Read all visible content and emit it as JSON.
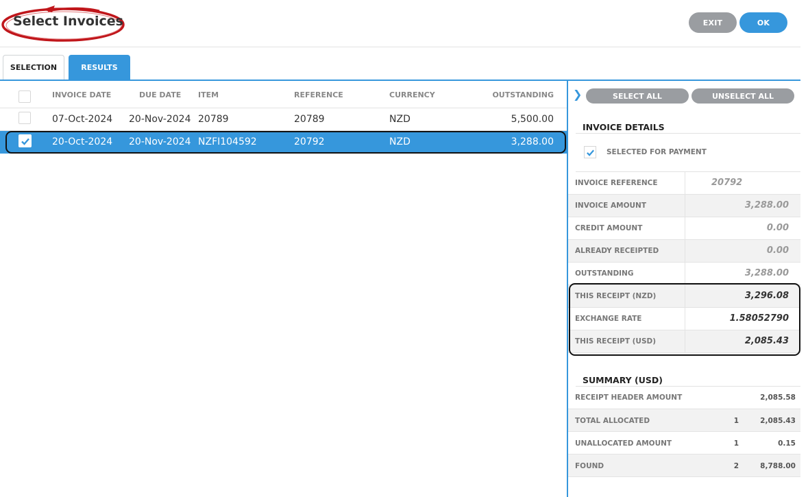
{
  "header": {
    "title": "Select Invoices",
    "exit_label": "EXIT",
    "ok_label": "OK",
    "colors": {
      "primary": "#3697dc",
      "grey_button": "#9a9da1",
      "annotation_red": "#c0161b"
    }
  },
  "tabs": [
    {
      "label": "SELECTION",
      "active": true
    },
    {
      "label": "RESULTS",
      "active": false
    }
  ],
  "table": {
    "columns": [
      "INVOICE DATE",
      "DUE DATE",
      "ITEM",
      "REFERENCE",
      "CURRENCY",
      "OUTSTANDING"
    ],
    "rows": [
      {
        "invoice_date": "07-Oct-2024",
        "due_date": "20-Nov-2024",
        "item": "20789",
        "reference": "20789",
        "currency": "NZD",
        "outstanding": "5,500.00",
        "checked": false
      },
      {
        "invoice_date": "20-Oct-2024",
        "due_date": "20-Nov-2024",
        "item": "NZFI104592",
        "reference": "20792",
        "currency": "NZD",
        "outstanding": "3,288.00",
        "checked": true
      }
    ]
  },
  "panel": {
    "select_all": "SELECT ALL",
    "unselect_all": "UNSELECT ALL",
    "details_title": "INVOICE DETAILS",
    "selected_for_payment": "SELECTED FOR PAYMENT",
    "details": [
      {
        "label": "INVOICE REFERENCE",
        "value": "20792"
      },
      {
        "label": "INVOICE AMOUNT",
        "value": "3,288.00"
      },
      {
        "label": "CREDIT AMOUNT",
        "value": "0.00"
      },
      {
        "label": "ALREADY RECEIPTED",
        "value": "0.00"
      },
      {
        "label": "OUTSTANDING",
        "value": "3,288.00"
      },
      {
        "label": "THIS RECEIPT (NZD)",
        "value": "3,296.08"
      },
      {
        "label": "EXCHANGE RATE",
        "value": "1.58052790"
      },
      {
        "label": "THIS RECEIPT (USD)",
        "value": "2,085.43"
      }
    ],
    "summary_title": "SUMMARY (USD)",
    "summary": [
      {
        "label": "RECEIPT HEADER AMOUNT",
        "count": "",
        "value": "2,085.58"
      },
      {
        "label": "TOTAL ALLOCATED",
        "count": "1",
        "value": "2,085.43"
      },
      {
        "label": "UNALLOCATED AMOUNT",
        "count": "1",
        "value": "0.15"
      },
      {
        "label": "FOUND",
        "count": "2",
        "value": "8,788.00"
      }
    ]
  }
}
